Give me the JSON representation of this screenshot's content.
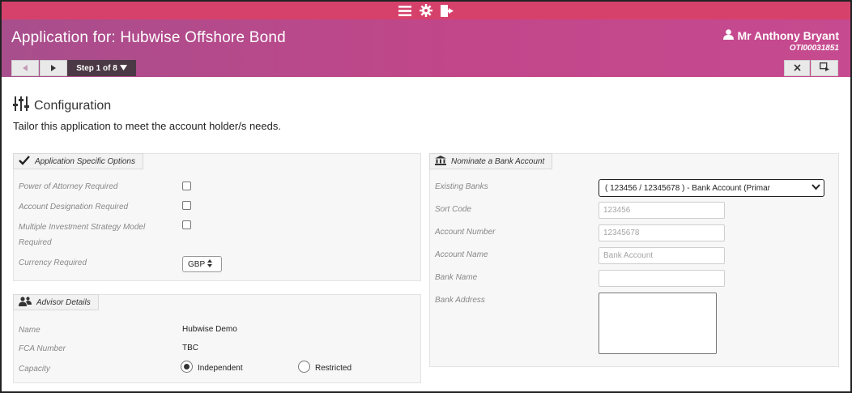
{
  "header": {
    "title": "Application for: Hubwise Offshore Bond",
    "user_name": "Mr Anthony Bryant",
    "user_ref": "OTI00031851",
    "step_label": "Step 1 of 8"
  },
  "topbar": {
    "icons": [
      "menu-icon",
      "gear-icon",
      "logout-icon"
    ]
  },
  "colors": {
    "topbar": "#d6416b",
    "header": "#b24a8c",
    "step": "#4b3a45"
  },
  "page": {
    "heading": "Configuration",
    "intro": "Tailor this application to meet the account holder/s needs."
  },
  "app_options": {
    "legend": "Application Specific Options",
    "power_of_attorney_label": "Power of Attorney Required",
    "account_designation_label": "Account Designation Required",
    "multi_strategy_label_1": "Multiple Investment Strategy Model",
    "multi_strategy_label_2": "Required",
    "currency_label": "Currency Required",
    "currency_value": "GBP"
  },
  "advisor": {
    "legend": "Advisor Details",
    "name_label": "Name",
    "name_value": "Hubwise Demo",
    "fca_label": "FCA Number",
    "fca_value": "TBC",
    "capacity_label": "Capacity",
    "capacity_options": [
      "Independent",
      "Restricted"
    ],
    "capacity_selected": "Independent"
  },
  "bank": {
    "legend": "Nominate a Bank Account",
    "existing_label": "Existing Banks",
    "existing_value": "( 123456 / 12345678 ) - Bank Account (Primar",
    "sort_code_label": "Sort Code",
    "sort_code_placeholder": "123456",
    "account_number_label": "Account Number",
    "account_number_placeholder": "12345678",
    "account_name_label": "Account Name",
    "account_name_placeholder": "Bank Account",
    "bank_name_label": "Bank Name",
    "bank_address_label": "Bank Address"
  }
}
